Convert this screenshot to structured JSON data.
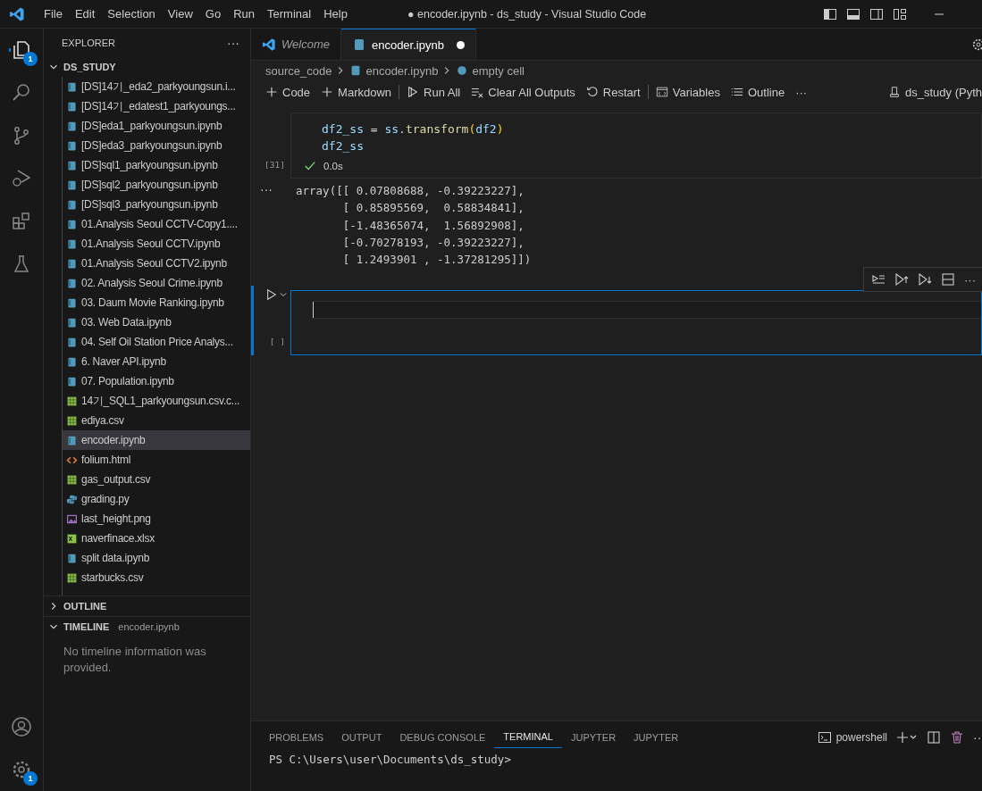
{
  "window": {
    "title": "● encoder.ipynb - ds_study - Visual Studio Code"
  },
  "menu": [
    "File",
    "Edit",
    "Selection",
    "View",
    "Go",
    "Run",
    "Terminal",
    "Help"
  ],
  "activity_bar": {
    "explorer_badge": "1",
    "settings_badge": "1"
  },
  "sidebar": {
    "title": "EXPLORER",
    "more": "···",
    "folder": {
      "name": "DS_STUDY",
      "expanded": true,
      "files": [
        {
          "name": "[DS]14기_eda2_parkyoungsun.i...",
          "kind": "notebook",
          "selected": false
        },
        {
          "name": "[DS]14기_edatest1_parkyoungs...",
          "kind": "notebook",
          "selected": false
        },
        {
          "name": "[DS]eda1_parkyoungsun.ipynb",
          "kind": "notebook",
          "selected": false
        },
        {
          "name": "[DS]eda3_parkyoungsun.ipynb",
          "kind": "notebook",
          "selected": false
        },
        {
          "name": "[DS]sql1_parkyoungsun.ipynb",
          "kind": "notebook",
          "selected": false
        },
        {
          "name": "[DS]sql2_parkyoungsun.ipynb",
          "kind": "notebook",
          "selected": false
        },
        {
          "name": "[DS]sql3_parkyoungsun.ipynb",
          "kind": "notebook",
          "selected": false
        },
        {
          "name": "01.Analysis Seoul CCTV-Copy1....",
          "kind": "notebook",
          "selected": false
        },
        {
          "name": "01.Analysis Seoul CCTV.ipynb",
          "kind": "notebook",
          "selected": false
        },
        {
          "name": "01.Analysis Seoul CCTV2.ipynb",
          "kind": "notebook",
          "selected": false
        },
        {
          "name": "02. Analysis Seoul Crime.ipynb",
          "kind": "notebook",
          "selected": false
        },
        {
          "name": "03. Daum Movie Ranking.ipynb",
          "kind": "notebook",
          "selected": false
        },
        {
          "name": "03. Web Data.ipynb",
          "kind": "notebook",
          "selected": false
        },
        {
          "name": "04. Self Oil Station Price Analys...",
          "kind": "notebook",
          "selected": false
        },
        {
          "name": "6. Naver API.ipynb",
          "kind": "notebook",
          "selected": false
        },
        {
          "name": "07. Population.ipynb",
          "kind": "notebook",
          "selected": false
        },
        {
          "name": "14기_SQL1_parkyoungsun.csv.c...",
          "kind": "csv",
          "selected": false
        },
        {
          "name": "ediya.csv",
          "kind": "csv",
          "selected": false
        },
        {
          "name": "encoder.ipynb",
          "kind": "notebook",
          "selected": true
        },
        {
          "name": "folium.html",
          "kind": "html",
          "selected": false
        },
        {
          "name": "gas_output.csv",
          "kind": "csv",
          "selected": false
        },
        {
          "name": "grading.py",
          "kind": "python",
          "selected": false
        },
        {
          "name": "last_height.png",
          "kind": "image",
          "selected": false
        },
        {
          "name": "naverfinace.xlsx",
          "kind": "excel",
          "selected": false
        },
        {
          "name": "split data.ipynb",
          "kind": "notebook",
          "selected": false
        },
        {
          "name": "starbucks.csv",
          "kind": "csv",
          "selected": false
        }
      ]
    },
    "outline": {
      "title": "OUTLINE",
      "expanded": false
    },
    "timeline": {
      "title": "TIMELINE",
      "expanded": true,
      "file": "encoder.ipynb",
      "message": "No timeline information was provided."
    }
  },
  "tabs": [
    {
      "label": "Welcome",
      "kind": "welcome",
      "selected": false,
      "dirty": false
    },
    {
      "label": "encoder.ipynb",
      "kind": "notebook",
      "selected": true,
      "dirty": true
    }
  ],
  "breadcrumbs": [
    {
      "label": "source_code",
      "kind": "folder"
    },
    {
      "label": "encoder.ipynb",
      "kind": "notebook"
    },
    {
      "label": "empty cell",
      "kind": "python"
    }
  ],
  "toolbar": [
    {
      "label": "Code",
      "kind": "plus"
    },
    {
      "label": "Markdown",
      "kind": "plus"
    },
    {
      "label": "Run All",
      "kind": "run"
    },
    {
      "label": "Clear All Outputs",
      "kind": "clear"
    },
    {
      "label": "Restart",
      "kind": "restart"
    },
    {
      "label": "Variables",
      "kind": "variables"
    },
    {
      "label": "Outline",
      "kind": "outline"
    }
  ],
  "toolbar_more": "···",
  "kernel": "ds_study (Pyth",
  "cells": [
    {
      "kind": "code",
      "execution_count": "[31]",
      "status": "0.0s",
      "succeeded": true,
      "selected": false,
      "lines": [
        [
          {
            "t": "df2_ss",
            "kind": "variable"
          },
          {
            "t": " = ",
            "kind": "plain"
          },
          {
            "t": "ss",
            "kind": "variable"
          },
          {
            "t": ".",
            "kind": "plain"
          },
          {
            "t": "transform",
            "kind": "function"
          },
          {
            "t": "(",
            "kind": "paren"
          },
          {
            "t": "df2",
            "kind": "variable"
          },
          {
            "t": ")",
            "kind": "paren"
          }
        ],
        [
          {
            "t": "df2_ss",
            "kind": "variable"
          }
        ]
      ],
      "output_more": "···",
      "output": [
        "array([[ 0.07808688, -0.39223227],",
        "       [ 0.85895569,  0.58834841],",
        "       [-1.48365074,  1.56892908],",
        "       [-0.70278193, -0.39223227],",
        "       [ 1.2493901 , -1.37281295]])"
      ]
    },
    {
      "kind": "code",
      "execution_count": "[ ]",
      "selected": true,
      "toolbar_more": "···"
    }
  ],
  "panel": {
    "tabs": [
      {
        "label": "PROBLEMS",
        "selected": false
      },
      {
        "label": "OUTPUT",
        "selected": false
      },
      {
        "label": "DEBUG CONSOLE",
        "selected": false
      },
      {
        "label": "TERMINAL",
        "selected": true
      },
      {
        "label": "JUPYTER",
        "selected": false
      },
      {
        "label": "JUPYTER",
        "selected": false
      }
    ],
    "shell": "powershell",
    "more": "···",
    "terminal_line": "PS C:\\Users\\user\\Documents\\ds_study>"
  }
}
